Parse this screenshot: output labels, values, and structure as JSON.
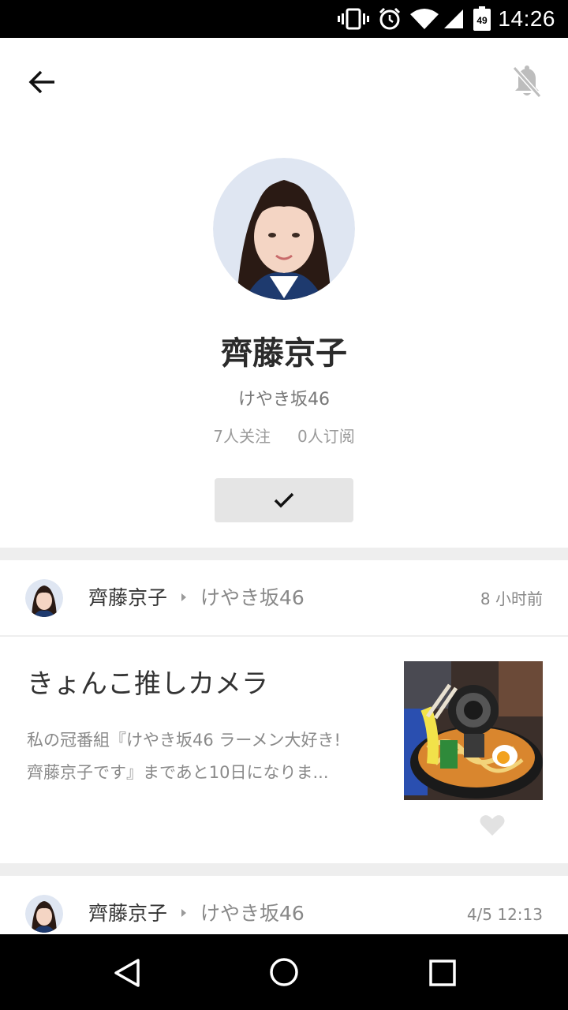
{
  "status_bar": {
    "time": "14:26",
    "battery_level": "49",
    "icons": [
      "vibrate-icon",
      "alarm-icon",
      "wifi-icon",
      "signal-icon",
      "battery-icon"
    ]
  },
  "app_bar": {
    "back_icon": "arrow-left-icon",
    "notification_icon": "bell-off-icon"
  },
  "profile": {
    "name": "齊藤京子",
    "group": "けやき坂46",
    "stats": {
      "followers": "7人关注",
      "subscribers": "0人订阅"
    },
    "follow_button_icon": "check-icon"
  },
  "posts": [
    {
      "author": "齊藤京子",
      "group": "けやき坂46",
      "time": "8 小时前",
      "title": "きょんこ推しカメラ",
      "excerpt_lines": [
        "私の冠番組『けやき坂46 ラーメン大好き!",
        "齊藤京子です』まであと10日になりま..."
      ],
      "thumbnail_icon": "ramen-photo",
      "like_icon": "heart-icon"
    },
    {
      "author": "齊藤京子",
      "group": "けやき坂46",
      "time": "4/5 12:13"
    }
  ],
  "nav_bar": {
    "icons": [
      "nav-back-icon",
      "nav-home-icon",
      "nav-recents-icon"
    ]
  },
  "colors": {
    "divider": "#eeeeee",
    "follow_button_bg": "#e5e5e5",
    "muted_text": "#888888"
  }
}
